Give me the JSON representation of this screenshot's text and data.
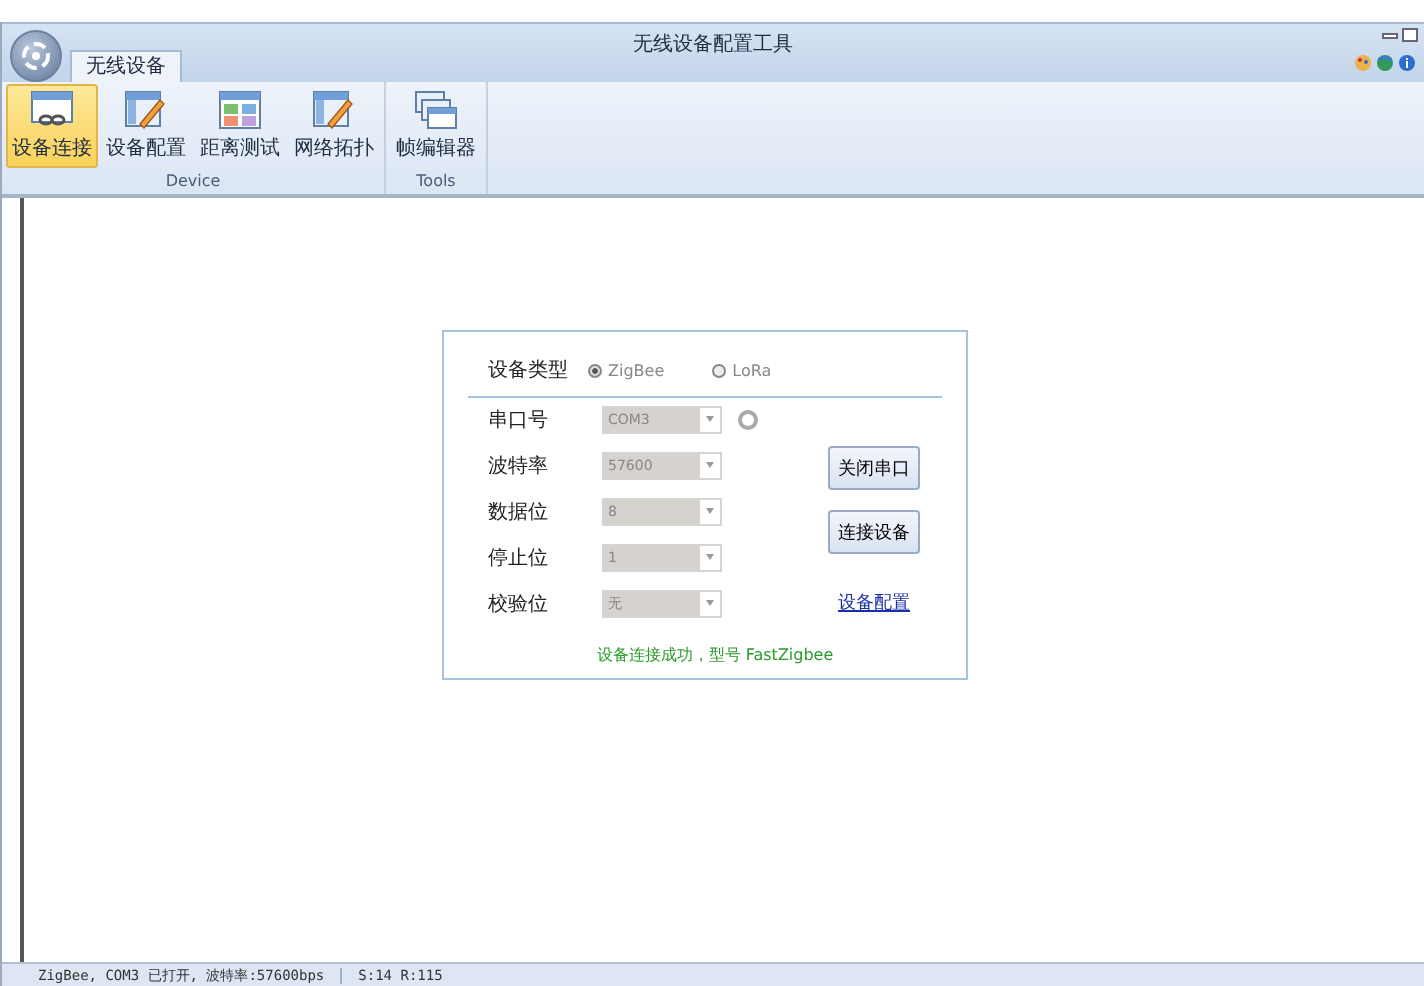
{
  "window": {
    "title": "无线设备配置工具"
  },
  "tabs": [
    {
      "label": "无线设备",
      "selected": true
    }
  ],
  "ribbon": {
    "groups": [
      {
        "label": "Device",
        "items": [
          {
            "label": "设备连接",
            "kind": "link",
            "selected": true
          },
          {
            "label": "设备配置",
            "kind": "edit",
            "selected": false
          },
          {
            "label": "距离测试",
            "kind": "grid",
            "selected": false
          },
          {
            "label": "网络拓扑",
            "kind": "edit",
            "selected": false
          }
        ]
      },
      {
        "label": "Tools",
        "items": [
          {
            "label": "帧编辑器",
            "kind": "stack",
            "selected": false
          }
        ]
      }
    ]
  },
  "form": {
    "device_type": {
      "label": "设备类型",
      "options": [
        {
          "label": "ZigBee",
          "selected": true
        },
        {
          "label": "LoRa",
          "selected": false
        }
      ]
    },
    "fields": [
      {
        "label": "串口号",
        "value": "COM3",
        "refresh": true
      },
      {
        "label": "波特率",
        "value": "57600",
        "refresh": false
      },
      {
        "label": "数据位",
        "value": "8",
        "refresh": false
      },
      {
        "label": "停止位",
        "value": "1",
        "refresh": false
      },
      {
        "label": "校验位",
        "value": "无",
        "refresh": false
      }
    ],
    "buttons": [
      "关闭串口",
      "连接设备"
    ],
    "link": "设备配置",
    "message": "设备连接成功，型号 FastZigbee"
  },
  "status_bar": {
    "items": [
      "ZigBee, COM3 已打开, 波特率:57600bps",
      "S:14  R:115"
    ]
  }
}
